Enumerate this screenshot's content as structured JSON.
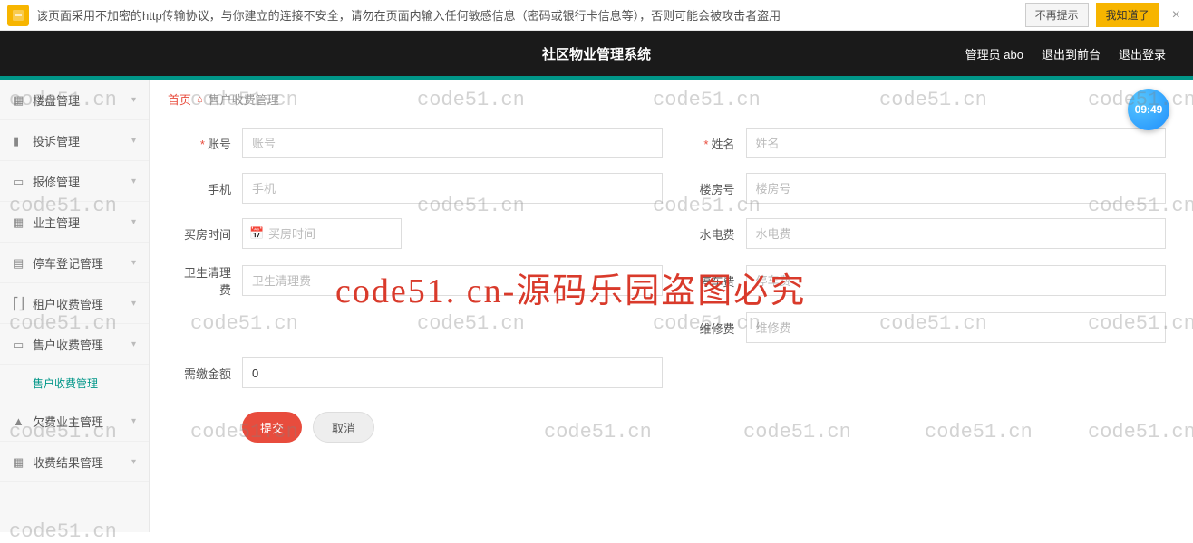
{
  "security": {
    "text": "该页面采用不加密的http传输协议，与你建立的连接不安全，请勿在页面内输入任何敏感信息（密码或银行卡信息等），否则可能会被攻击者盗用",
    "dismiss_btn": "不再提示",
    "ok_btn": "我知道了"
  },
  "header": {
    "title": "社区物业管理系统",
    "user": "管理员 abo",
    "front": "退出到前台",
    "logout": "退出登录"
  },
  "sidebar": {
    "items": [
      {
        "label": "楼盘管理"
      },
      {
        "label": "投诉管理"
      },
      {
        "label": "报修管理"
      },
      {
        "label": "业主管理"
      },
      {
        "label": "停车登记管理"
      },
      {
        "label": "租户收费管理"
      },
      {
        "label": "售户收费管理"
      },
      {
        "label": "欠费业主管理"
      },
      {
        "label": "收费结果管理"
      }
    ],
    "sub_active": "售户收费管理"
  },
  "breadcrumb": {
    "home": "首页",
    "current": "售户收费管理"
  },
  "form": {
    "account_label": "账号",
    "account_ph": "账号",
    "name_label": "姓名",
    "name_ph": "姓名",
    "phone_label": "手机",
    "phone_ph": "手机",
    "room_label": "楼房号",
    "room_ph": "楼房号",
    "buytime_label": "买房时间",
    "buytime_ph": "买房时间",
    "utility_label": "水电费",
    "utility_ph": "水电费",
    "clean_label": "卫生清理费",
    "clean_ph": "卫生清理费",
    "parking_label": "停车费",
    "parking_ph": "停车费",
    "repair_label": "维修费",
    "repair_ph": "维修费",
    "total_label": "需缴金额",
    "total_value": "0",
    "submit": "提交",
    "cancel": "取消"
  },
  "clock": "09:49",
  "watermark": {
    "small": "code51.cn",
    "big": "code51. cn-源码乐园盗图必究"
  }
}
